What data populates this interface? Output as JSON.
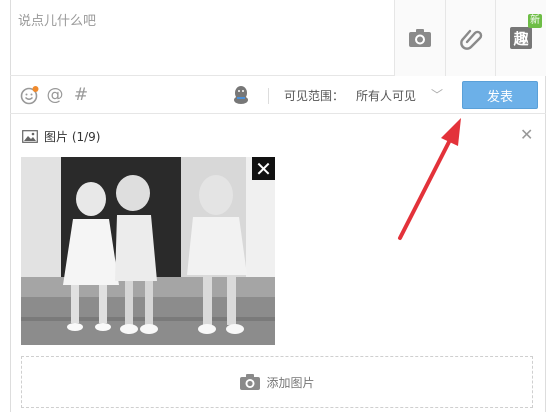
{
  "compose": {
    "placeholder": "说点儿什么吧"
  },
  "attachments": {
    "new_badge": "新",
    "fun_label": "趣"
  },
  "toolbar": {
    "visibility_label": "可见范围：",
    "visibility_value": "所有人可见",
    "publish_label": "发表"
  },
  "image_panel": {
    "title": "图片 (1/9)",
    "add_label": "添加图片"
  },
  "colors": {
    "publish_button": "#6cb0e8",
    "annotation_arrow": "#e3323a",
    "new_badge": "#6dbd45"
  }
}
